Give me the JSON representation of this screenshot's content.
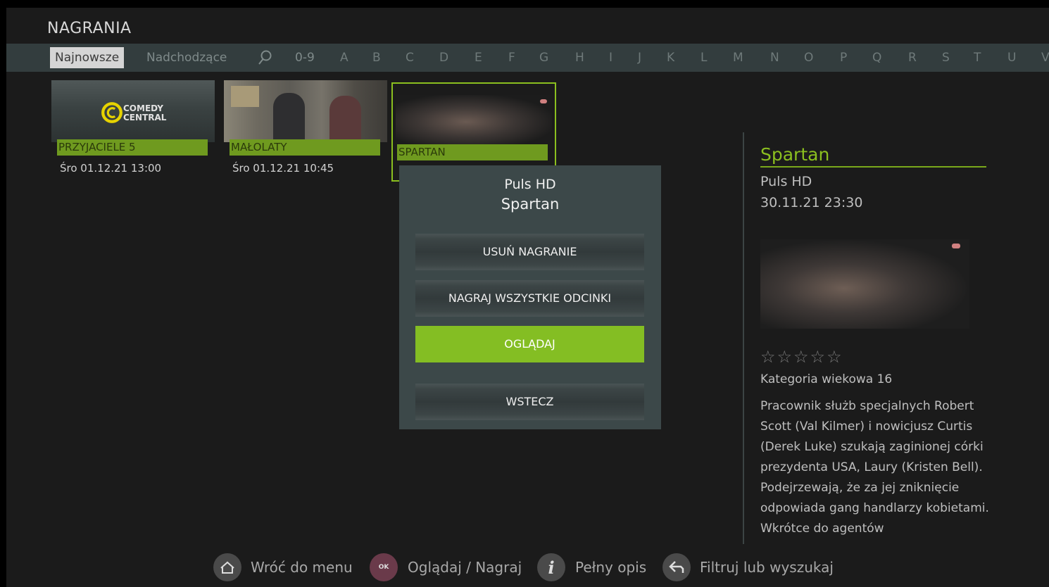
{
  "page": {
    "title": "NAGRANIA"
  },
  "tabs": {
    "newest": "Najnowsze",
    "upcoming": "Nadchodzące",
    "digits": "0-9"
  },
  "letters": [
    "A",
    "B",
    "C",
    "D",
    "E",
    "F",
    "G",
    "H",
    "I",
    "J",
    "K",
    "L",
    "M",
    "N",
    "O",
    "P",
    "Q",
    "R",
    "S",
    "T",
    "U",
    "V"
  ],
  "recordings": [
    {
      "title": "PRZYJACIELE 5",
      "time": "Śro 01.12.21 13:00",
      "logo_line1": "COMEDY",
      "logo_line2": "CENTRAL"
    },
    {
      "title": "MAŁOLATY",
      "time": "Śro 01.12.21 10:45"
    },
    {
      "title": "SPARTAN"
    }
  ],
  "detail": {
    "title": "Spartan",
    "channel": "Puls HD",
    "date": "30.11.21 23:30",
    "stars": "☆☆☆☆☆",
    "age_rating": "Kategoria wiekowa 16",
    "description": "Pracownik służb specjalnych Robert Scott (Val Kilmer) i nowicjusz Curtis (Derek Luke) szukają zaginionej córki prezydenta USA, Laury (Kristen Bell). Podejrzewają, że za jej zniknięcie odpowiada gang handlarzy kobietami. Wkrótce do agentów"
  },
  "modal": {
    "channel": "Puls HD",
    "title": "Spartan",
    "buttons": [
      "USUŃ NAGRANIE",
      "NAGRAJ WSZYSTKIE ODCINKI",
      "OGLĄDAJ",
      "WSTECZ"
    ]
  },
  "footer": {
    "menu": "Wróć do menu",
    "ok_icon": "OK",
    "watch": "Oglądaj / Nagraj",
    "info": "Pełny opis",
    "filter": "Filtruj lub wyszukaj"
  },
  "colors": {
    "accent": "#84be23",
    "background": "#1b1b1b",
    "tabbar": "#333d3e",
    "modal": "#3c4849"
  }
}
